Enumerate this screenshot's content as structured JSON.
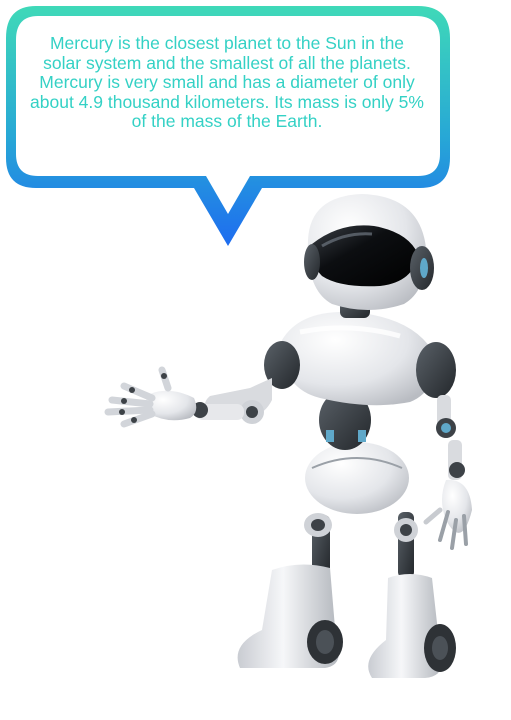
{
  "speech_bubble": {
    "text": "Mercury is the closest planet to the Sun in the solar system and the smallest of all the planets. Mercury is very small and has a diameter of only about 4.9 thousand kilometers. Its mass is only 5% of the mass of the Earth.",
    "text_color": "#34d1c5",
    "border_gradient_top": "#3fd9b8",
    "border_gradient_bottom": "#1e6cf0"
  },
  "robot": {
    "description_icon": "robot-figure",
    "body_color": "#e9eaee",
    "joint_color": "#3d4247",
    "visor_color": "#111317",
    "accent_color": "#5fa8c9"
  }
}
